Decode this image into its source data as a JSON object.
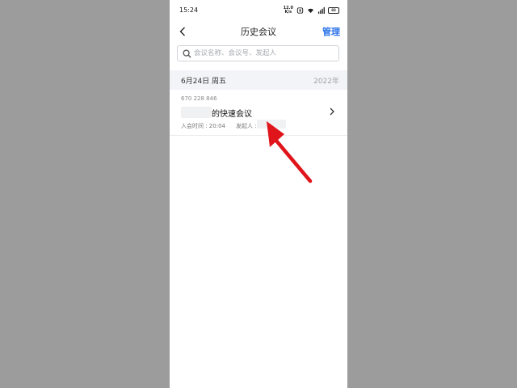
{
  "status_bar": {
    "time": "15:24",
    "net_speed_top": "12.0",
    "net_speed_bottom": "K/s",
    "battery": "83"
  },
  "header": {
    "back_icon": "chevron-left-icon",
    "title": "历史会议",
    "manage_label": "管理"
  },
  "search": {
    "icon": "search-icon",
    "placeholder": "会议名称、会议号、发起人"
  },
  "date_section": {
    "date": "6月24日 周五",
    "year": "2022年"
  },
  "meeting": {
    "id": "670 228 846",
    "title": "的快速会议",
    "join_time": "入会时间 : 20:04",
    "host_label": "发起人 :",
    "chevron_icon": "chevron-right-icon"
  },
  "colors": {
    "accent": "#2e75e8",
    "annotation_arrow": "#e0141b",
    "background": "#9c9c9c"
  }
}
